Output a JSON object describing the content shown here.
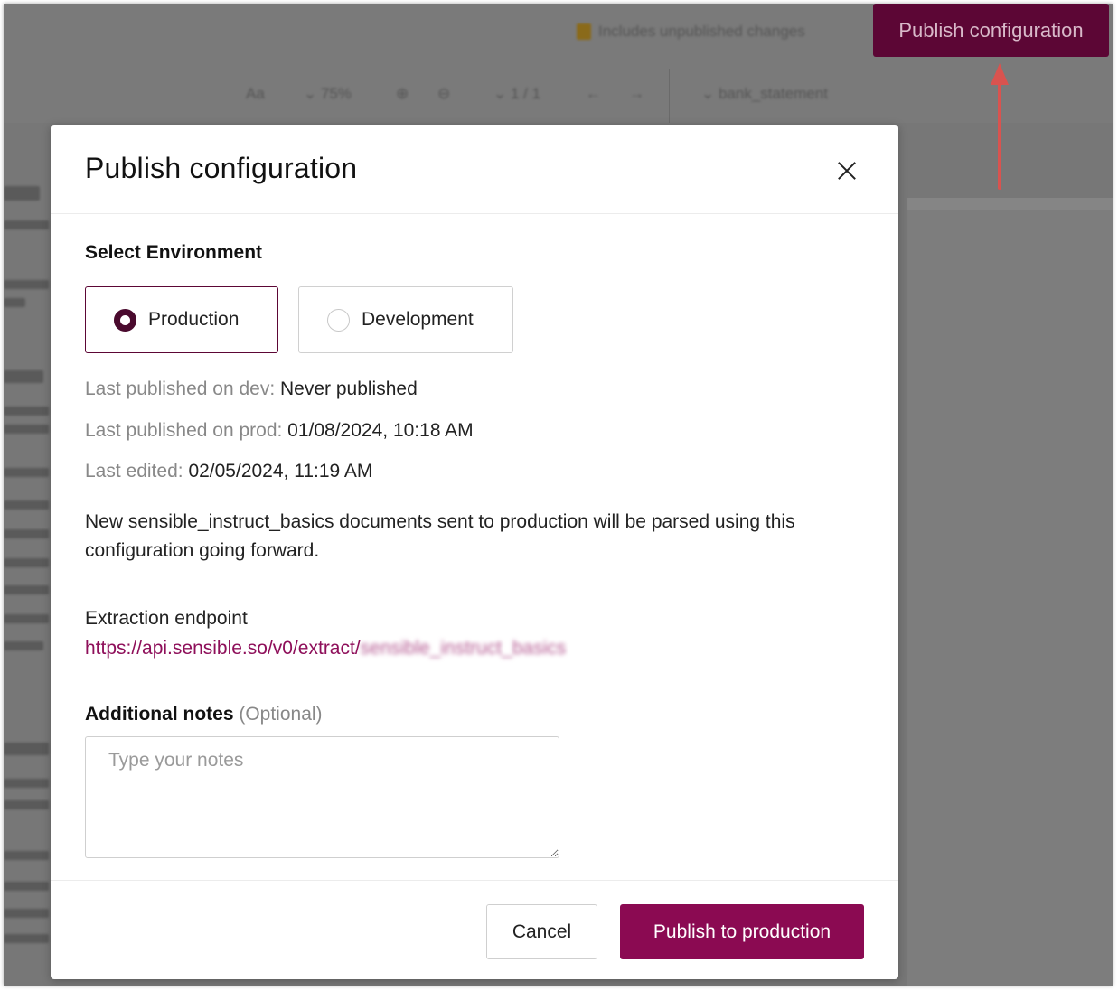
{
  "topbar": {
    "status_text": "Includes unpublished changes",
    "publish_button": "Publish configuration"
  },
  "toolbar": {
    "zoom": "75%",
    "page": "1 / 1",
    "doc_type": "bank_statement"
  },
  "modal": {
    "title": "Publish configuration",
    "env_section_label": "Select Environment",
    "environments": [
      {
        "label": "Production",
        "selected": true
      },
      {
        "label": "Development",
        "selected": false
      }
    ],
    "meta": {
      "dev_key": "Last published on dev:",
      "dev_val": "Never published",
      "prod_key": "Last published on prod:",
      "prod_val": "01/08/2024, 10:18 AM",
      "edited_key": "Last edited:",
      "edited_val": "02/05/2024, 11:19 AM"
    },
    "description": "New sensible_instruct_basics documents sent to production will be parsed using this configuration going forward.",
    "endpoint_label": "Extraction endpoint",
    "endpoint_url": "https://api.sensible.so/v0/extract/",
    "endpoint_suffix": "sensible_instruct_basics",
    "notes_label": "Additional notes",
    "notes_optional": "(Optional)",
    "notes_placeholder": "Type your notes",
    "cancel_button": "Cancel",
    "publish_button": "Publish to production"
  },
  "colors": {
    "brand": "#8b0a52",
    "brand_dark": "#5c0635",
    "annotation_arrow": "#d9534f"
  }
}
